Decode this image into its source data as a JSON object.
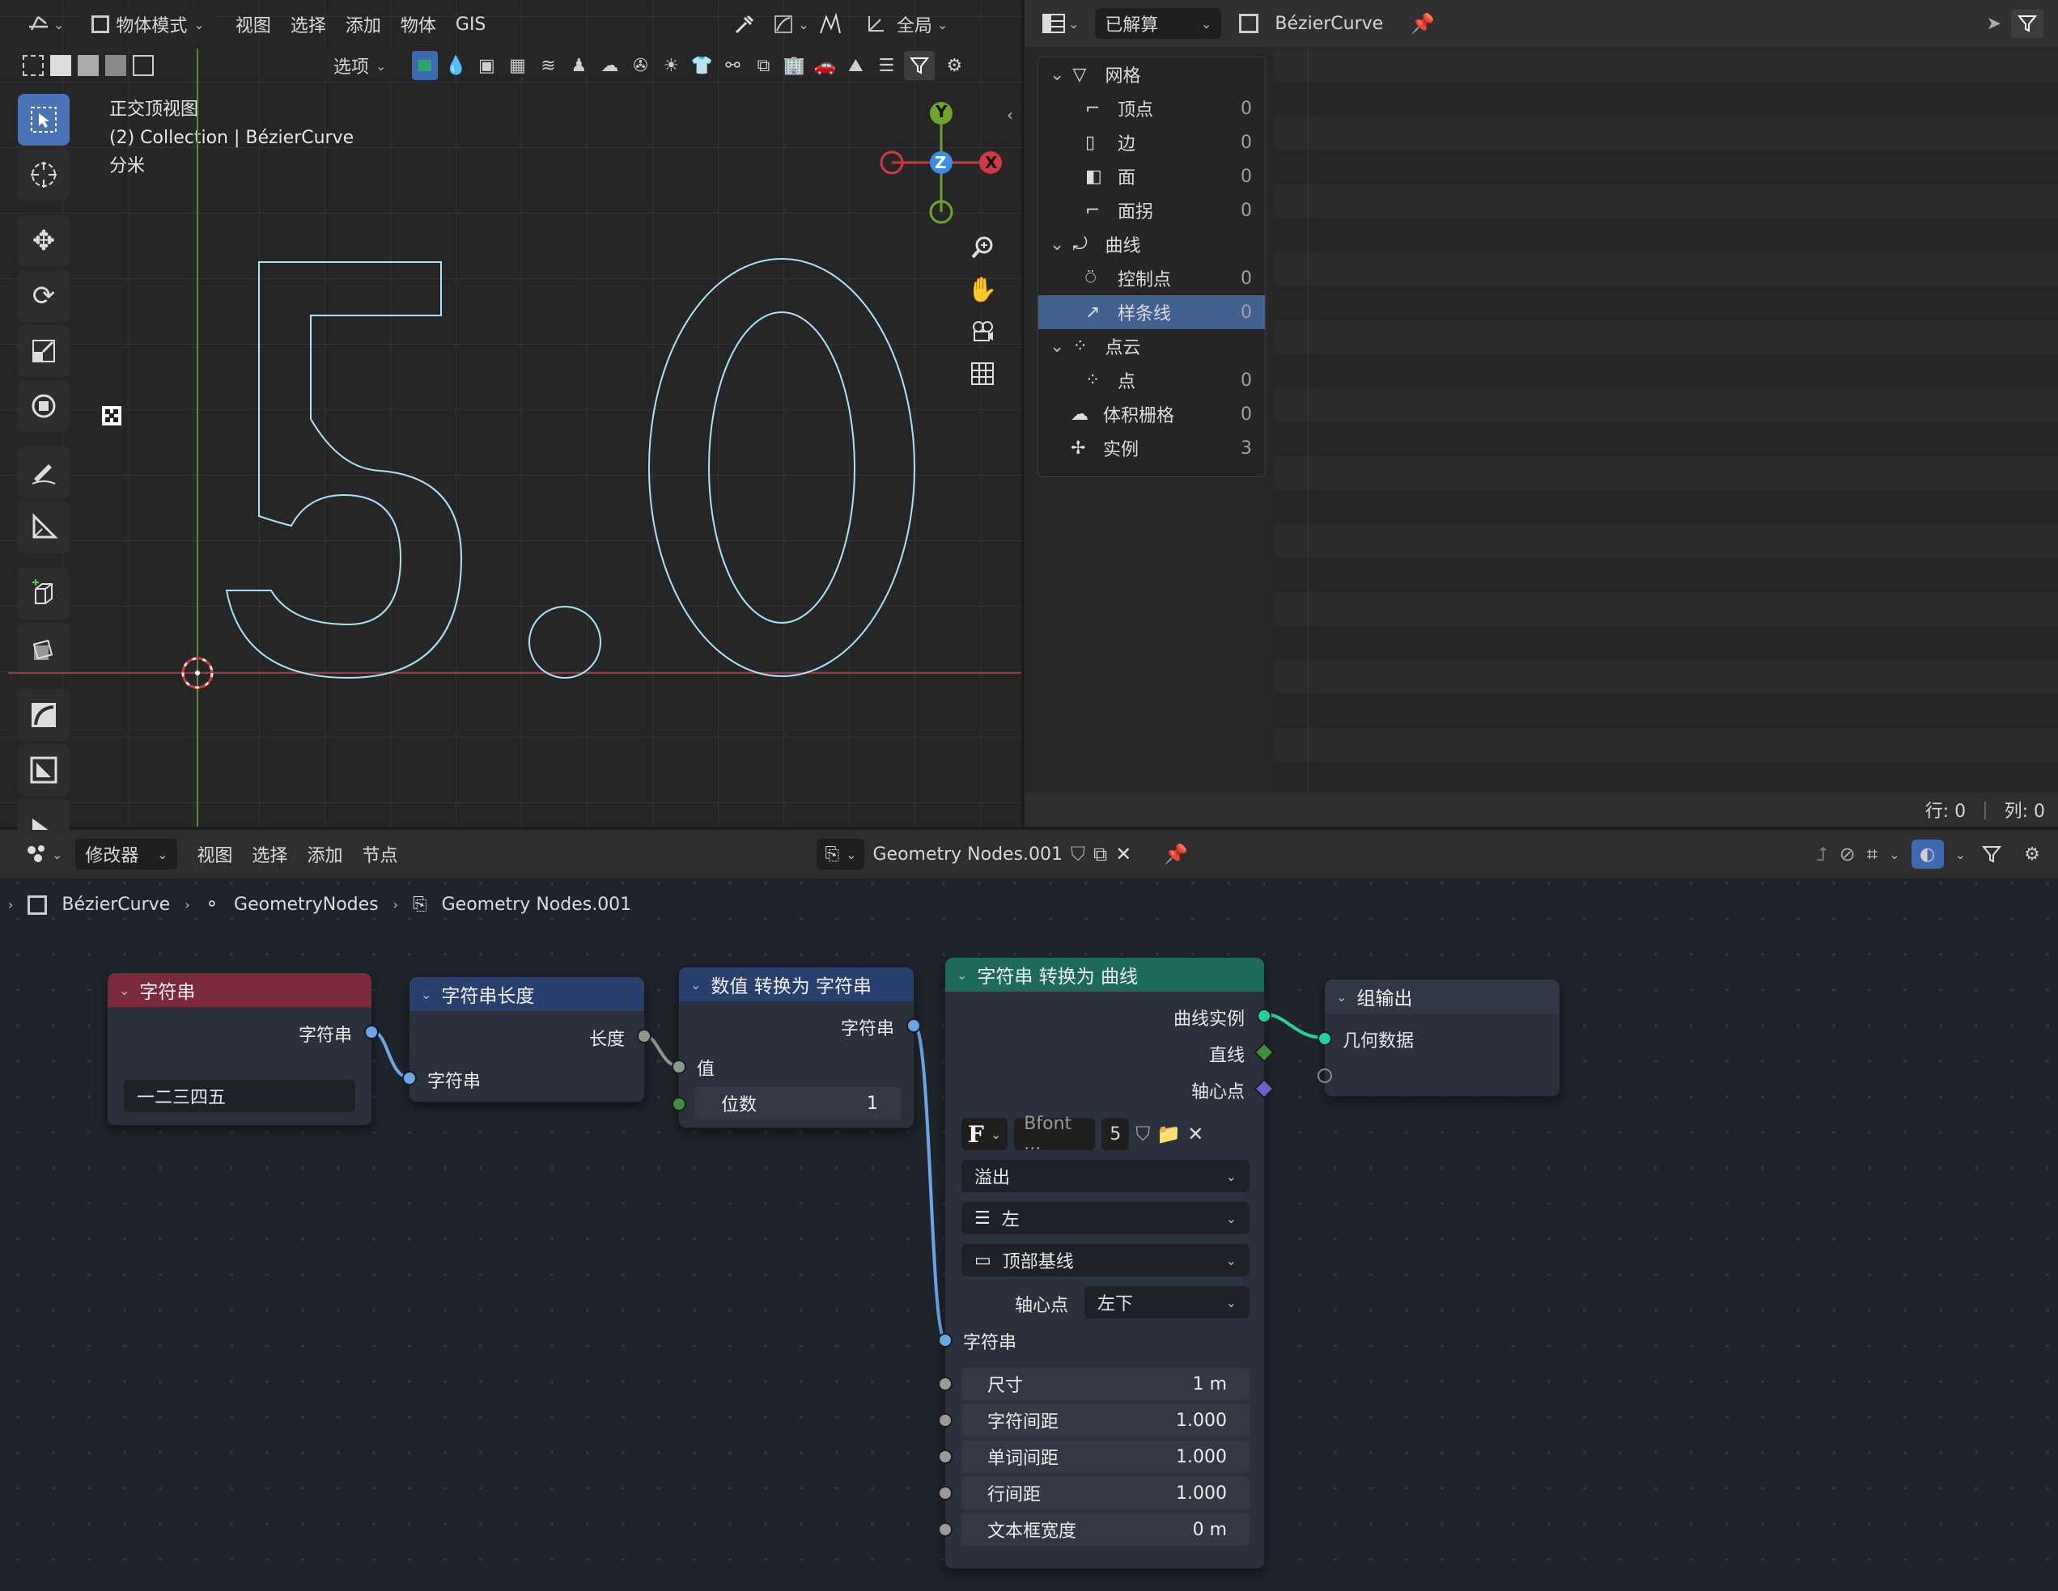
{
  "viewport": {
    "mode": "物体模式",
    "menus": [
      "视图",
      "选择",
      "添加",
      "物体",
      "GIS"
    ],
    "transform_space": "全局",
    "options": "选项",
    "view_name": "正交顶视图",
    "collection_info": "(2) Collection | BézierCurve",
    "unit": "分米",
    "gizmo": {
      "y": "Y",
      "z": "Z",
      "x": "X"
    },
    "text_display": "5.0"
  },
  "spreadsheet": {
    "evaluated": "已解算",
    "object": "BézierCurve",
    "tree": [
      {
        "label": "网格",
        "count": "",
        "level": 0
      },
      {
        "label": "顶点",
        "count": "0",
        "level": 1
      },
      {
        "label": "边",
        "count": "0",
        "level": 1
      },
      {
        "label": "面",
        "count": "0",
        "level": 1
      },
      {
        "label": "面拐",
        "count": "0",
        "level": 1
      },
      {
        "label": "曲线",
        "count": "",
        "level": 0
      },
      {
        "label": "控制点",
        "count": "0",
        "level": 1
      },
      {
        "label": "样条线",
        "count": "0",
        "level": 1
      },
      {
        "label": "点云",
        "count": "",
        "level": 0
      },
      {
        "label": "点",
        "count": "0",
        "level": 1
      },
      {
        "label": "体积栅格",
        "count": "0",
        "level": 0
      },
      {
        "label": "实例",
        "count": "3",
        "level": 0
      }
    ],
    "status_rows": "行: 0",
    "status_cols": "列: 0"
  },
  "node_editor": {
    "editor_type": "修改器",
    "menus": [
      "视图",
      "选择",
      "添加",
      "节点"
    ],
    "node_group": "Geometry Nodes.001",
    "breadcrumb": [
      "BézierCurve",
      "GeometryNodes",
      "Geometry Nodes.001"
    ],
    "nodes": {
      "string": {
        "title": "字符串",
        "out": "字符串",
        "value": "一二三四五"
      },
      "string_length": {
        "title": "字符串长度",
        "out": "长度",
        "in": "字符串"
      },
      "value_to_string": {
        "title": "数值 转换为 字符串",
        "out": "字符串",
        "in_value": "值",
        "decimals_label": "位数",
        "decimals": "1"
      },
      "string_to_curves": {
        "title": "字符串 转换为 曲线",
        "out_instances": "曲线实例",
        "out_line": "直线",
        "out_pivot": "轴心点",
        "font": "Bfont ...",
        "font_users": "5",
        "overflow": "溢出",
        "align_x": "左",
        "align_y": "顶部基线",
        "pivot_label": "轴心点",
        "pivot_mode": "左下",
        "in_string": "字符串",
        "fields": [
          {
            "label": "尺寸",
            "value": "1 m"
          },
          {
            "label": "字符间距",
            "value": "1.000"
          },
          {
            "label": "单词间距",
            "value": "1.000"
          },
          {
            "label": "行间距",
            "value": "1.000"
          },
          {
            "label": "文本框宽度",
            "value": "0 m"
          }
        ]
      },
      "group_output": {
        "title": "组输出",
        "in": "几何数据"
      }
    }
  },
  "colors": {
    "accent_blue": "#4873b6",
    "string_node": "#7a2a3a",
    "converter_node": "#27406e",
    "geometry_node": "#1d6a5a",
    "output_node": "#303846",
    "socket_string": "#6aa7e8",
    "socket_float": "#8a9a8a",
    "socket_geometry": "#1fd3a0",
    "curve_outline": "#a8e4f5"
  }
}
